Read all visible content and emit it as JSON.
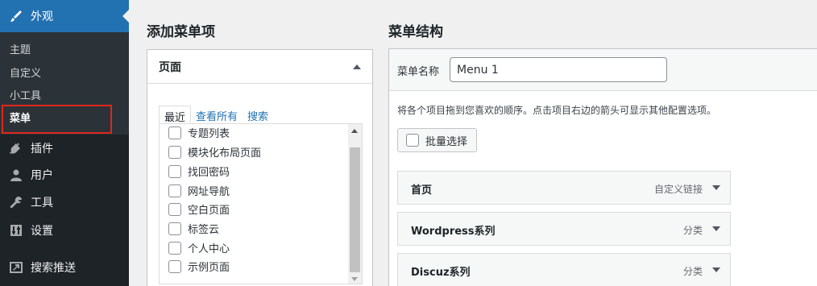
{
  "sidebar": {
    "top_item": {
      "label": "外观",
      "icon": "paintbrush-icon"
    },
    "submenu": [
      {
        "label": "主题"
      },
      {
        "label": "自定义"
      },
      {
        "label": "小工具"
      },
      {
        "label": "菜单",
        "current": true
      }
    ],
    "items": [
      {
        "label": "插件",
        "icon": "plugin-icon"
      },
      {
        "label": "用户",
        "icon": "user-icon"
      },
      {
        "label": "工具",
        "icon": "wrench-icon"
      },
      {
        "label": "设置",
        "icon": "settings-icon"
      },
      {
        "label": "搜索推送",
        "icon": "push-icon"
      }
    ],
    "colors": {
      "background": "#1d2327",
      "active": "#2271b1",
      "highlight": "#e0261c"
    }
  },
  "add_items": {
    "title": "添加菜单项",
    "panel_title": "页面",
    "tabs": [
      "最近",
      "查看所有",
      "搜索"
    ],
    "pages": [
      "专题列表",
      "模块化布局页面",
      "找回密码",
      "网址导航",
      "空白页面",
      "标签云",
      "个人中心",
      "示例页面"
    ]
  },
  "menu_structure": {
    "title": "菜单结构",
    "name_label": "菜单名称",
    "name_value": "Menu 1",
    "instructions": "将各个项目拖到您喜欢的顺序。点击项目右边的箭头可显示其他配置选项。",
    "bulk_select": "批量选择",
    "items": [
      {
        "title": "首页",
        "type": "自定义链接"
      },
      {
        "title": "Wordpress系列",
        "type": "分类"
      },
      {
        "title": "Discuz系列",
        "type": "分类"
      }
    ]
  }
}
